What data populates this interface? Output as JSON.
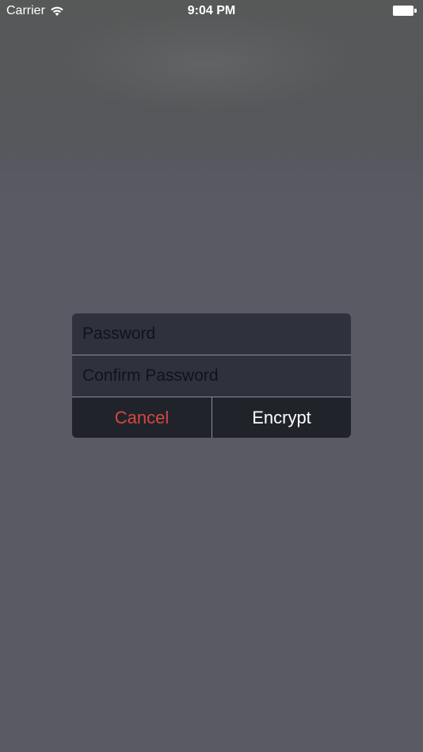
{
  "status_bar": {
    "carrier": "Carrier",
    "time": "9:04 PM",
    "wifi_icon": "wifi-icon",
    "battery_icon": "battery-icon"
  },
  "dialog": {
    "password_placeholder": "Password",
    "confirm_placeholder": "Confirm Password",
    "cancel_label": "Cancel",
    "encrypt_label": "Encrypt"
  },
  "colors": {
    "cancel": "#d64745",
    "encrypt": "#ffffff",
    "field_background": "#2f323c",
    "button_background": "#20232a",
    "screen_background": "#5a5a65"
  }
}
